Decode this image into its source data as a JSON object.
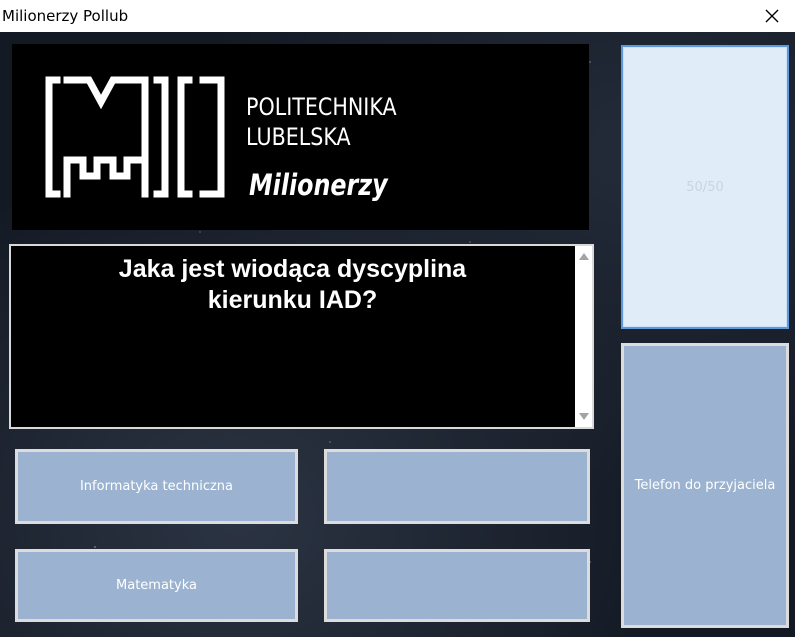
{
  "window": {
    "title": "Milionerzy Pollub"
  },
  "logo": {
    "university_line1": "POLITECHNIKA",
    "university_line2": "LUBELSKA",
    "game_name": "Milionerzy"
  },
  "question": {
    "line1": "Jaka jest wiodąca dyscyplina",
    "line2": "kierunku IAD?"
  },
  "answers": [
    {
      "label": "Informatyka techniczna"
    },
    {
      "label": ""
    },
    {
      "label": "Matematyka"
    },
    {
      "label": ""
    }
  ],
  "lifelines": {
    "fifty_fifty": "50/50",
    "phone_a_friend": "Telefon do przyjaciela"
  },
  "colors": {
    "button_fill": "#9bb3d0",
    "button_border": "#dcdcdc",
    "active_button_fill": "#e1ecf9",
    "active_button_border": "#5d98dc",
    "panel_black": "#000000",
    "background_space": "#141a24"
  },
  "icons": {
    "close": "close-icon",
    "scroll_up": "scroll-up-arrow-icon",
    "scroll_down": "scroll-down-arrow-icon"
  }
}
